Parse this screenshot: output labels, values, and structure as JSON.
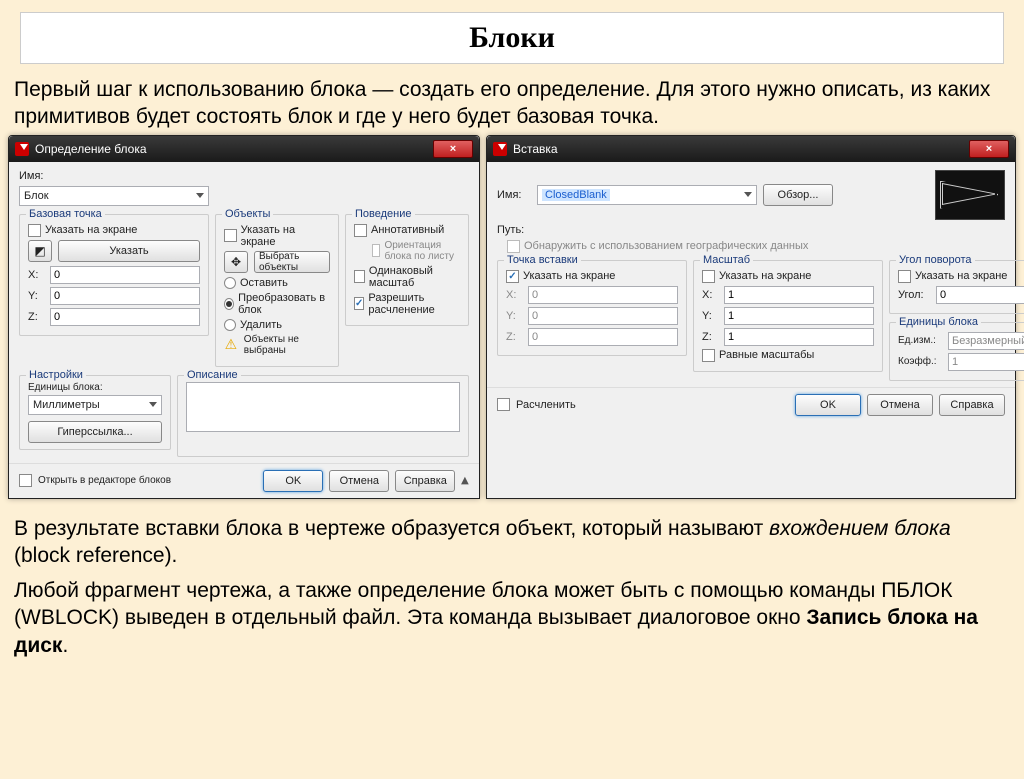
{
  "page": {
    "title": "Блоки",
    "intro": "Первый шаг к использованию блока — создать его определение. Для этого нужно описать, из каких примитивов будет состоять блок и где у него будет базовая точка.",
    "outro_p1_a": "В результате вставки блока в чертеже образуется объект, который называют ",
    "outro_p1_em": "вхождением блока",
    "outro_p1_b": " (block reference).",
    "outro_p2_a": "Любой фрагмент чертежа, а также определение блока может быть с помощью команды ПБЛОК (WBLOCK) выведен в отдельный файл. Эта команда вызывает диалоговое окно ",
    "outro_p2_bold": "Запись блока на диск",
    "outro_p2_b": "."
  },
  "dlg1": {
    "title": "Определение блока",
    "name_label": "Имя:",
    "name_value": "Блок",
    "base_point": {
      "legend": "Базовая точка",
      "specify_on_screen": "Указать на экране",
      "pick_button": "Указать",
      "x_label": "X:",
      "x_val": "0",
      "y_label": "Y:",
      "y_val": "0",
      "z_label": "Z:",
      "z_val": "0"
    },
    "objects": {
      "legend": "Объекты",
      "specify_on_screen": "Указать на экране",
      "select_button": "Выбрать объекты",
      "retain": "Оставить",
      "convert": "Преобразовать в блок",
      "delete": "Удалить",
      "no_objects": "Объекты не выбраны"
    },
    "behavior": {
      "legend": "Поведение",
      "annotative": "Аннотативный",
      "orientation": "Ориентация блока по листу",
      "scale_uniform": "Одинаковый масштаб",
      "allow_exploding": "Разрешить расчленение"
    },
    "settings": {
      "legend": "Настройки",
      "units_label": "Единицы блока:",
      "units_value": "Миллиметры",
      "hyperlink": "Гиперссылка..."
    },
    "description": {
      "legend": "Описание"
    },
    "open_in_editor": "Открыть в редакторе блоков",
    "ok": "OK",
    "cancel": "Отмена",
    "help": "Справка"
  },
  "dlg2": {
    "title": "Вставка",
    "name_label": "Имя:",
    "name_value": "ClosedBlank",
    "browse": "Обзор...",
    "path_label": "Путь:",
    "geo": "Обнаружить с использованием географических данных",
    "insert_point": {
      "legend": "Точка вставки",
      "specify": "Указать на экране",
      "x_label": "X:",
      "x_val": "0",
      "y_label": "Y:",
      "y_val": "0",
      "z_label": "Z:",
      "z_val": "0"
    },
    "scale": {
      "legend": "Масштаб",
      "specify": "Указать на экране",
      "x_label": "X:",
      "x_val": "1",
      "y_label": "Y:",
      "y_val": "1",
      "z_label": "Z:",
      "z_val": "1",
      "uniform": "Равные масштабы"
    },
    "rotation": {
      "legend": "Угол поворота",
      "specify": "Указать на экране",
      "angle_label": "Угол:",
      "angle_val": "0"
    },
    "block_unit": {
      "legend": "Единицы блока",
      "unit_label": "Ед.изм.:",
      "unit_val": "Безразмерный",
      "factor_label": "Коэфф.:",
      "factor_val": "1"
    },
    "explode": "Расчленить",
    "ok": "OK",
    "cancel": "Отмена",
    "help": "Справка"
  }
}
